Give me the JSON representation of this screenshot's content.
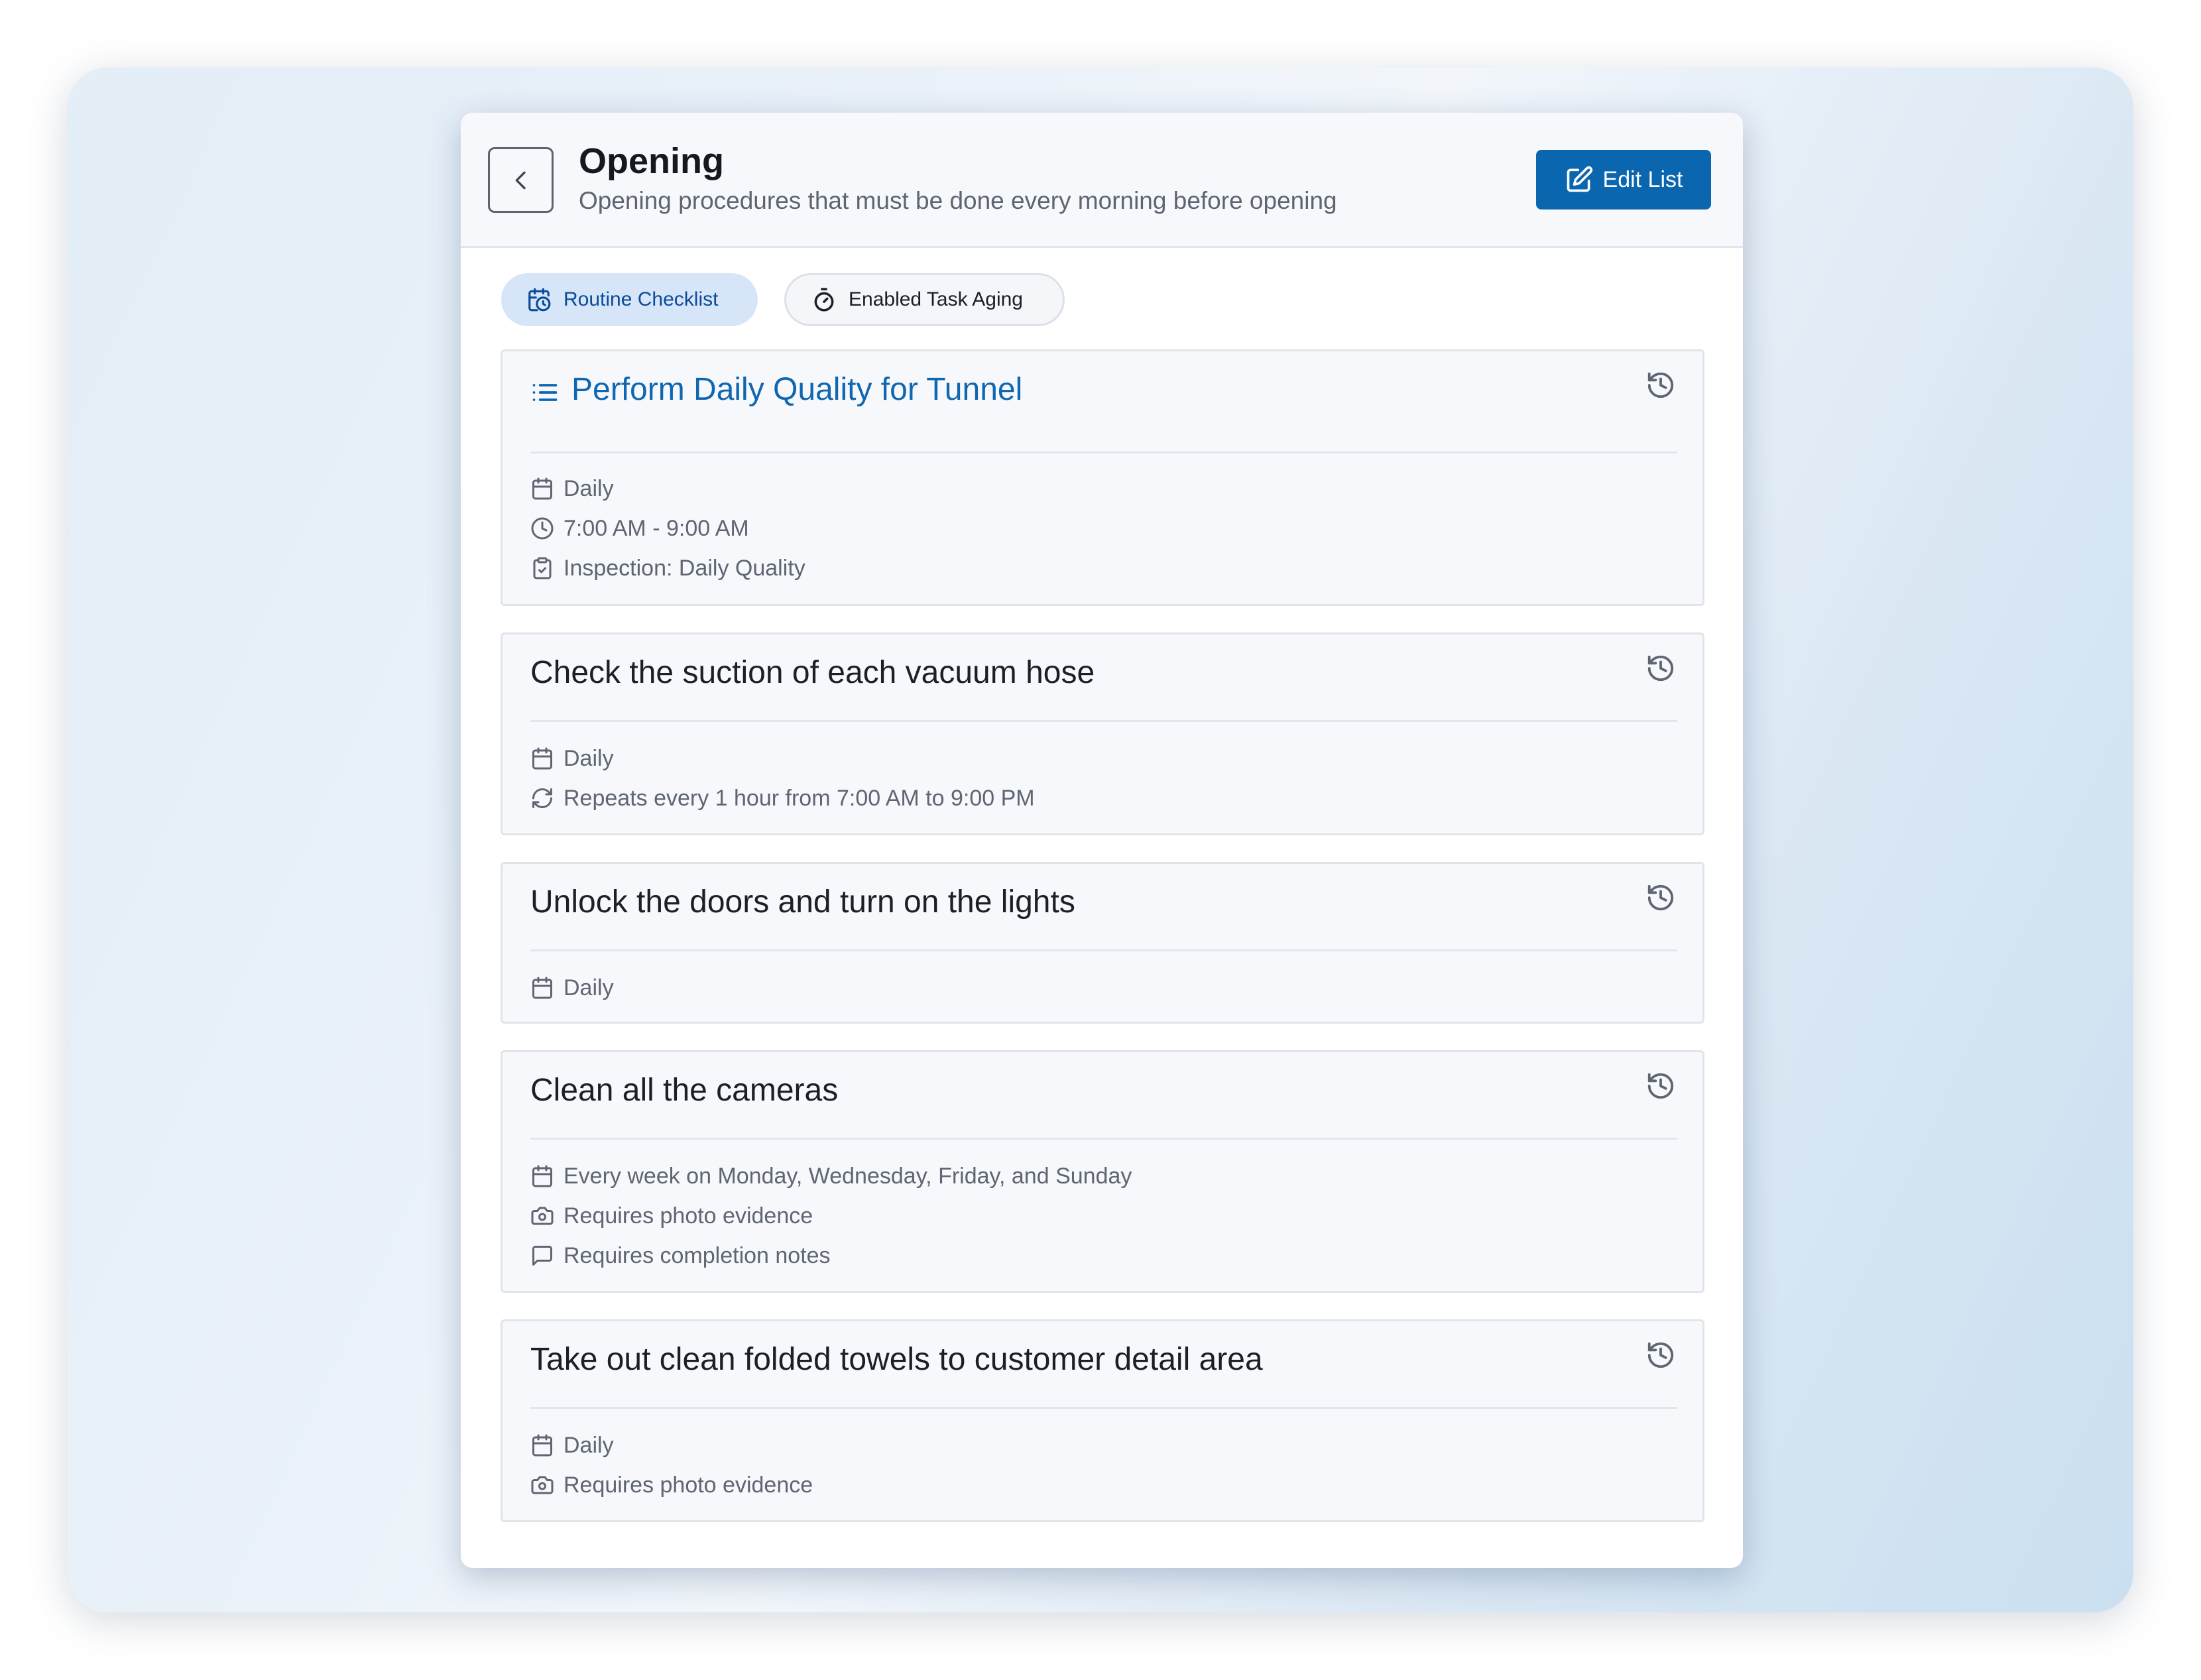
{
  "header": {
    "title": "Opening",
    "subtitle": "Opening procedures that must be done every morning before opening",
    "edit_label": "Edit List"
  },
  "tags": {
    "routine": "Routine Checklist",
    "aging": "Enabled Task Aging"
  },
  "tasks": [
    {
      "title": "Perform Daily Quality for Tunnel",
      "is_link": true,
      "meta": [
        {
          "icon": "calendar-icon",
          "text": "Daily"
        },
        {
          "icon": "clock-icon",
          "text": "7:00 AM - 9:00 AM"
        },
        {
          "icon": "clipboard-icon",
          "text": "Inspection: Daily Quality"
        }
      ]
    },
    {
      "title": "Check the suction of each vacuum hose",
      "meta": [
        {
          "icon": "calendar-icon",
          "text": "Daily"
        },
        {
          "icon": "repeat-icon",
          "text": "Repeats every 1 hour from 7:00 AM to 9:00 PM"
        }
      ]
    },
    {
      "title": "Unlock the doors and turn on the lights",
      "meta": [
        {
          "icon": "calendar-icon",
          "text": "Daily"
        }
      ]
    },
    {
      "title": "Clean all the cameras",
      "meta": [
        {
          "icon": "calendar-icon",
          "text": "Every week on Monday, Wednesday, Friday, and Sunday"
        },
        {
          "icon": "camera-icon",
          "text": "Requires photo evidence"
        },
        {
          "icon": "comment-icon",
          "text": "Requires completion notes"
        }
      ]
    },
    {
      "title": "Take out clean folded towels to customer detail area",
      "meta": [
        {
          "icon": "calendar-icon",
          "text": "Daily"
        },
        {
          "icon": "camera-icon",
          "text": "Requires photo evidence"
        }
      ]
    }
  ],
  "colors": {
    "accent": "#0b66b0",
    "link": "#0f67b1",
    "tag_bg": "#d6e6f8",
    "meta_text": "#5e6573"
  }
}
